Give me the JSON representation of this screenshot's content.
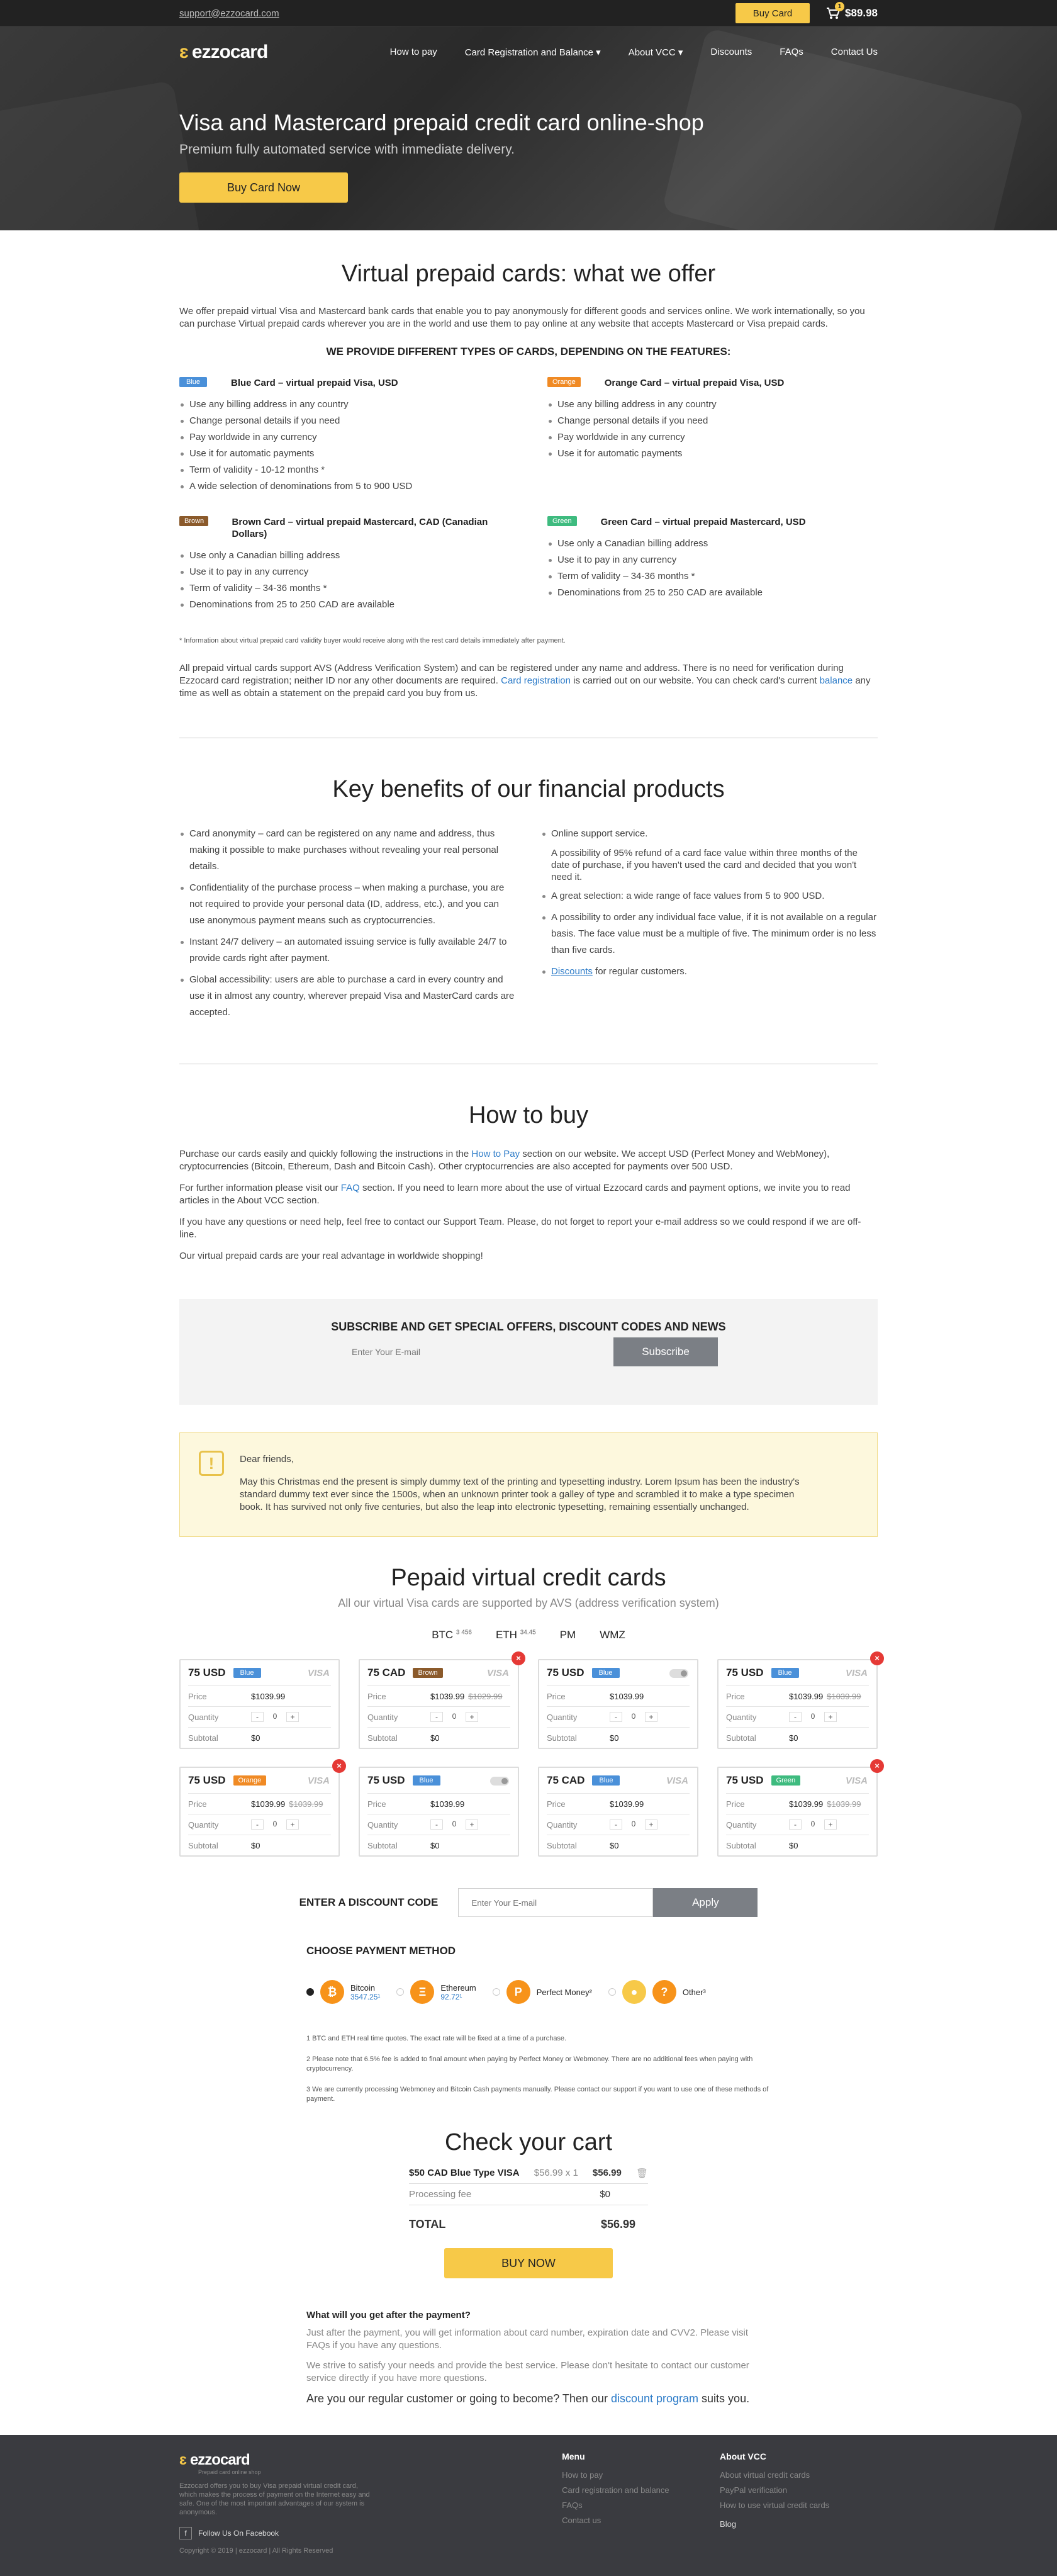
{
  "topbar": {
    "email": "support@ezzocard.com",
    "buy_card": "Buy Card",
    "cart_count": "1",
    "cart_total": "$89.98"
  },
  "nav": {
    "logo": "ezzocard",
    "links": [
      "How to pay",
      "Card Registration and Balance ▾",
      "About VCC ▾",
      "Discounts",
      "FAQs",
      "Contact Us"
    ]
  },
  "hero": {
    "title": "Visa and Mastercard prepaid credit card online-shop",
    "subtitle": "Premium fully automated service with immediate delivery.",
    "cta": "Buy Card Now"
  },
  "offer": {
    "title": "Virtual prepaid cards: what we offer",
    "intro": "We offer prepaid virtual Visa and Mastercard bank cards that enable you to pay anonymously for different goods and services online. We work internationally, so you can purchase Virtual prepaid cards wherever you are in the world and use them to pay online at any website that accepts Mastercard or Visa prepaid cards.",
    "types_title": "WE PROVIDE DIFFERENT TYPES OF CARDS, DEPENDING ON THE FEATURES:",
    "types": [
      {
        "tag": "Blue",
        "color": "blue",
        "title": "Blue Card – virtual prepaid Visa, USD",
        "items": [
          "Use any billing address in any country",
          "Change personal details if you need",
          "Pay worldwide in any currency",
          "Use it for automatic payments",
          "Term of validity - 10-12 months *",
          "A wide selection of denominations from 5 to 900 USD"
        ]
      },
      {
        "tag": "Orange",
        "color": "orange",
        "title": "Orange Card – virtual prepaid Visa, USD",
        "items": [
          "Use any billing address in any country",
          "Change personal details if you need",
          "Pay worldwide in any currency",
          "Use it for automatic payments"
        ]
      },
      {
        "tag": "Brown",
        "color": "brown",
        "title": "Brown Card – virtual prepaid Mastercard, CAD (Canadian Dollars)",
        "items": [
          "Use only a Canadian billing address",
          "Use it to pay in any currency",
          "Term of validity – 34-36 months *",
          "Denominations from 25 to 250 CAD are available"
        ]
      },
      {
        "tag": "Green",
        "color": "green",
        "title": "Green Card – virtual prepaid Mastercard, USD",
        "items": [
          "Use only a Canadian billing address",
          "Use it to pay in any currency",
          "Term of validity – 34-36 months *",
          "Denominations from 25 to 250 CAD are available"
        ]
      }
    ],
    "note": "* Information about virtual prepaid card validity buyer would receive along with the rest card details immediately after payment.",
    "avs_1": "All prepaid virtual cards support AVS (Address Verification System) and can be registered under any name and address. There is no need for verification during Ezzocard card registration; neither ID nor any other documents are required.",
    "avs_link1": "Card registration",
    "avs_2": "is carried out on our website. You can check card's current",
    "avs_link2": "balance",
    "avs_3": "any time as well as obtain a statement on the prepaid card you buy from us."
  },
  "benefits": {
    "title": "Key benefits of our financial products",
    "left": [
      "Card anonymity – card can be registered on any name and address, thus making it possible to make purchases without revealing your real personal details.",
      "Confidentiality of the purchase process – when making a purchase, you are not required to provide your personal data (ID, address, etc.), and you can use anonymous payment means such as cryptocurrencies.",
      "Instant 24/7 delivery – an automated issuing service is fully available 24/7 to provide cards right after payment.",
      "Global accessibility: users are able to purchase a card in every country and use it in almost any country, wherever prepaid Visa and MasterCard cards are accepted."
    ],
    "right_1": "Online support service.",
    "right_1_sub": "A possibility of 95% refund of a card face value within three months of the date of purchase, if you haven't used the card and decided that you won't need it.",
    "right_2": "A great selection: a wide range of face values from 5 to 900 USD.",
    "right_3": "A possibility to order any individual face value, if it is not available on a regular basis. The face value must be a multiple of five. The minimum order is no less than five cards.",
    "right_4_link": "Discounts",
    "right_4": "for regular customers."
  },
  "howto": {
    "title": "How to buy",
    "p1a": "Purchase our cards easily and quickly following the instructions in the",
    "p1link": "How to Pay",
    "p1b": "section on our website. We accept USD (Perfect Money and WebMoney), cryptocurrencies (Bitcoin, Ethereum, Dash and Bitcoin Cash). Other cryptocurrencies are also accepted for payments over 500 USD.",
    "p2a": "For further information please visit our",
    "p2link": "FAQ",
    "p2b": "section. If you need to learn more about the use of virtual Ezzocard cards and payment options, we invite you to read articles in the About VCC section.",
    "p3": "If you have any questions or need help, feel free to contact our Support Team. Please, do not forget to report your e-mail address so we could respond if we are off-line.",
    "p4": "Our virtual prepaid cards are your real advantage in worldwide shopping!"
  },
  "subscribe": {
    "title": "SUBSCRIBE AND GET SPECIAL OFFERS, DISCOUNT CODES AND NEWS",
    "placeholder": "Enter Your E-mail",
    "button": "Subscribe"
  },
  "notice": {
    "greeting": "Dear friends,",
    "text": "May this Christmas end the present is simply dummy text of the printing and typesetting industry. Lorem Ipsum has been the industry's standard dummy text ever since the 1500s, when an unknown printer took a galley of type and scrambled it to make a type specimen book. It has survived not only five centuries, but also the leap into electronic typesetting, remaining essentially unchanged."
  },
  "products": {
    "title": "Pepaid virtual credit cards",
    "subtitle": "All our virtual Visa cards are supported by AVS (address verification system)",
    "currencies": [
      {
        "name": "BTC",
        "rate": "3 456"
      },
      {
        "name": "ETH",
        "rate": "34.45"
      },
      {
        "name": "PM",
        "rate": ""
      },
      {
        "name": "WMZ",
        "rate": ""
      }
    ],
    "labels": {
      "price": "Price",
      "quantity": "Quantity",
      "subtotal": "Subtotal"
    },
    "cards": [
      {
        "amount": "75 USD",
        "tag": "Blue",
        "color": "blue",
        "brand": "VISA",
        "price": "$1039.99",
        "old": "",
        "qty": "0",
        "subtotal": "$0",
        "no": false,
        "toggle": false
      },
      {
        "amount": "75 CAD",
        "tag": "Brown",
        "color": "brown",
        "brand": "VISA",
        "price": "$1039.99",
        "old": "$1029.99",
        "qty": "0",
        "subtotal": "$0",
        "no": true,
        "toggle": false
      },
      {
        "amount": "75 USD",
        "tag": "Blue",
        "color": "blue",
        "brand": "",
        "price": "$1039.99",
        "old": "",
        "qty": "0",
        "subtotal": "$0",
        "no": false,
        "toggle": true
      },
      {
        "amount": "75 USD",
        "tag": "Blue",
        "color": "blue",
        "brand": "VISA",
        "price": "$1039.99",
        "old": "$1039.99",
        "qty": "0",
        "subtotal": "$0",
        "no": true,
        "toggle": false
      },
      {
        "amount": "75 USD",
        "tag": "Orange",
        "color": "orange",
        "brand": "VISA",
        "price": "$1039.99",
        "old": "$1039.99",
        "qty": "0",
        "subtotal": "$0",
        "no": true,
        "toggle": false
      },
      {
        "amount": "75 USD",
        "tag": "Blue",
        "color": "blue",
        "brand": "",
        "price": "$1039.99",
        "old": "",
        "qty": "0",
        "subtotal": "$0",
        "no": false,
        "toggle": true
      },
      {
        "amount": "75 CAD",
        "tag": "Blue",
        "color": "blue",
        "brand": "VISA",
        "price": "$1039.99",
        "old": "",
        "qty": "0",
        "subtotal": "$0",
        "no": false,
        "toggle": false
      },
      {
        "amount": "75 USD",
        "tag": "Green",
        "color": "green",
        "brand": "VISA",
        "price": "$1039.99",
        "old": "$1039.99",
        "qty": "0",
        "subtotal": "$0",
        "no": true,
        "toggle": false
      }
    ]
  },
  "discount": {
    "label": "ENTER A DISCOUNT CODE",
    "placeholder": "Enter Your E-mail",
    "button": "Apply"
  },
  "payment": {
    "title": "CHOOSE PAYMENT METHOD",
    "methods": [
      {
        "name": "Bitcoin",
        "value": "3547.25¹",
        "selected": true
      },
      {
        "name": "Ethereum",
        "value": "92.72¹",
        "selected": false
      },
      {
        "name": "Perfect Money²",
        "value": "",
        "selected": false
      },
      {
        "name": "Other³",
        "value": "",
        "selected": false
      }
    ],
    "notes": [
      "1 BTC and ETH real time quotes. The exact rate will be fixed at a time of a purchase.",
      "2 Please note that 6.5% fee is added to final amount when paying by Perfect Money or Webmoney. There are no additional fees when paying with cryptocurrency.",
      "3 We are currently processing Webmoney and Bitcoin Cash payments manually. Please contact our support if you want to use one of these methods of payment."
    ]
  },
  "cart": {
    "title": "Check your cart",
    "item": "$50 CAD Blue Type VISA",
    "item_qty": "$56.99 x 1",
    "item_price": "$56.99",
    "fee_label": "Processing fee",
    "fee": "$0",
    "total_label": "TOTAL",
    "total": "$56.99",
    "buy": "BUY NOW"
  },
  "after": {
    "title": "What will you get after the payment?",
    "p1": "Just after the payment, you will get information about card number, expiration date and CVV2. Please visit FAQs if you have any questions.",
    "p2": "We strive to satisfy your needs and provide the best service. Please don't hesitate to contact our customer service directly if you have more questions.",
    "p3a": "Are you our regular customer or going to become? Then our",
    "p3link": "discount program",
    "p3b": "suits you."
  },
  "footer": {
    "logo": "ezzocard",
    "tagline": "Prepaid card online shop",
    "desc": "Ezzocard offers you to buy Visa prepaid virtual credit card, which makes the process of payment on the Internet easy and safe. One of the most important advantages of our system is anonymous.",
    "fb": "Follow Us On Facebook",
    "copy": "Copyright © 2019 | ezzocard | All Rights Reserved",
    "menu_title": "Menu",
    "menu": [
      "How to pay",
      "Card registration and balance",
      "FAQs",
      "Contact us"
    ],
    "about_title": "About VCC",
    "about": [
      "About virtual credit cards",
      "PayPal verification",
      "How to use virtual credit cards"
    ],
    "blog": "Blog"
  }
}
